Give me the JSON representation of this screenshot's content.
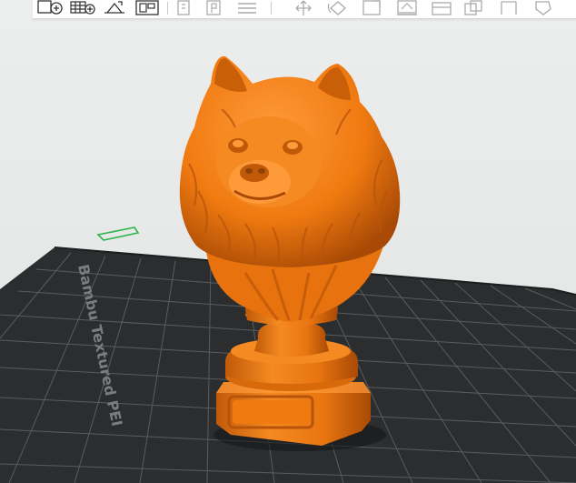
{
  "bed": {
    "label": "Bambu Textured PEI",
    "colors": {
      "plate": "#2c2d2f",
      "grid": "#5f6164",
      "label": "#7a7c80"
    }
  },
  "model": {
    "color": "#f07a10",
    "shadow_color": "#b8540a",
    "highlight_color": "#ffa048"
  },
  "axis": {
    "color": "#2fb34a"
  },
  "toolbar": {
    "tools": [
      {
        "name": "add-object-icon"
      },
      {
        "name": "add-plate-icon"
      },
      {
        "name": "auto-orient-icon"
      },
      {
        "name": "arrange-icon"
      },
      {
        "name": "split-objects-icon"
      },
      {
        "name": "split-parts-icon"
      },
      {
        "name": "layers-icon"
      },
      {
        "name": "move-icon"
      },
      {
        "name": "rotate-icon"
      },
      {
        "name": "scale-icon"
      },
      {
        "name": "lay-on-face-icon"
      },
      {
        "name": "cut-icon"
      },
      {
        "name": "mesh-boolean-icon"
      },
      {
        "name": "support-paint-icon"
      },
      {
        "name": "seam-paint-icon"
      }
    ]
  }
}
